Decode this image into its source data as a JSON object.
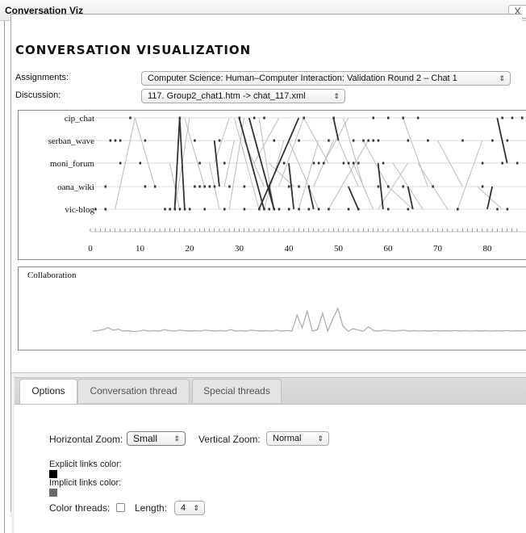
{
  "window": {
    "title": "Conversation Viz",
    "close_label": "X"
  },
  "heading": "CONVERSATION VISUALIZATION",
  "assignments": {
    "label": "Assignments:",
    "value": "Computer Science: Human–Computer Interaction: Validation Round 2 – Chat 1"
  },
  "discussion": {
    "label": "Discussion:",
    "value": "117. Group2_chat1.htm -> chat_117.xml"
  },
  "graph": {
    "participants": [
      "cip_chat",
      "serban_wave",
      "moni_forum",
      "oana_wiki",
      "vic-blog"
    ],
    "x_ticks": [
      "0",
      "10",
      "20",
      "30",
      "40",
      "50",
      "60",
      "70",
      "80"
    ]
  },
  "collaboration": {
    "label": "Collaboration",
    "values": [
      0.05,
      0.06,
      0.08,
      0.12,
      0.07,
      0.09,
      0.05,
      0.06,
      0.04,
      0.05,
      0.07,
      0.05,
      0.06,
      0.05,
      0.08,
      0.06,
      0.05,
      0.07,
      0.06,
      0.05,
      0.06,
      0.05,
      0.07,
      0.06,
      0.05,
      0.06,
      0.05,
      0.08,
      0.05,
      0.06,
      0.05,
      0.07,
      0.06,
      0.05,
      0.06,
      0.05,
      0.07,
      0.05,
      0.06,
      0.05,
      0.38,
      0.12,
      0.46,
      0.05,
      0.08,
      0.42,
      0.05,
      0.3,
      0.52,
      0.15,
      0.05,
      0.1,
      0.07,
      0.05,
      0.14,
      0.06,
      0.05,
      0.07,
      0.06,
      0.05,
      0.06,
      0.07,
      0.05,
      0.06,
      0.05,
      0.06,
      0.05,
      0.06,
      0.05,
      0.06,
      0.05,
      0.06,
      0.05,
      0.06,
      0.05,
      0.06,
      0.05,
      0.06,
      0.05,
      0.06,
      0.05,
      0.06,
      0.05,
      0.06,
      0.05,
      0.06
    ]
  },
  "tabs": [
    "Options",
    "Conversation thread",
    "Special threads"
  ],
  "options": {
    "horizontal_zoom_label": "Horizontal Zoom:",
    "horizontal_zoom_value": "Small",
    "vertical_zoom_label": "Vertical Zoom:",
    "vertical_zoom_value": "Normal",
    "explicit_links_label": "Explicit links color:",
    "explicit_links_color": "#000000",
    "implicit_links_label": "Implicit links color:",
    "implicit_links_color": "#6b6b6b",
    "color_threads_label": "Color threads:",
    "length_label": "Length:",
    "length_value": "4"
  }
}
